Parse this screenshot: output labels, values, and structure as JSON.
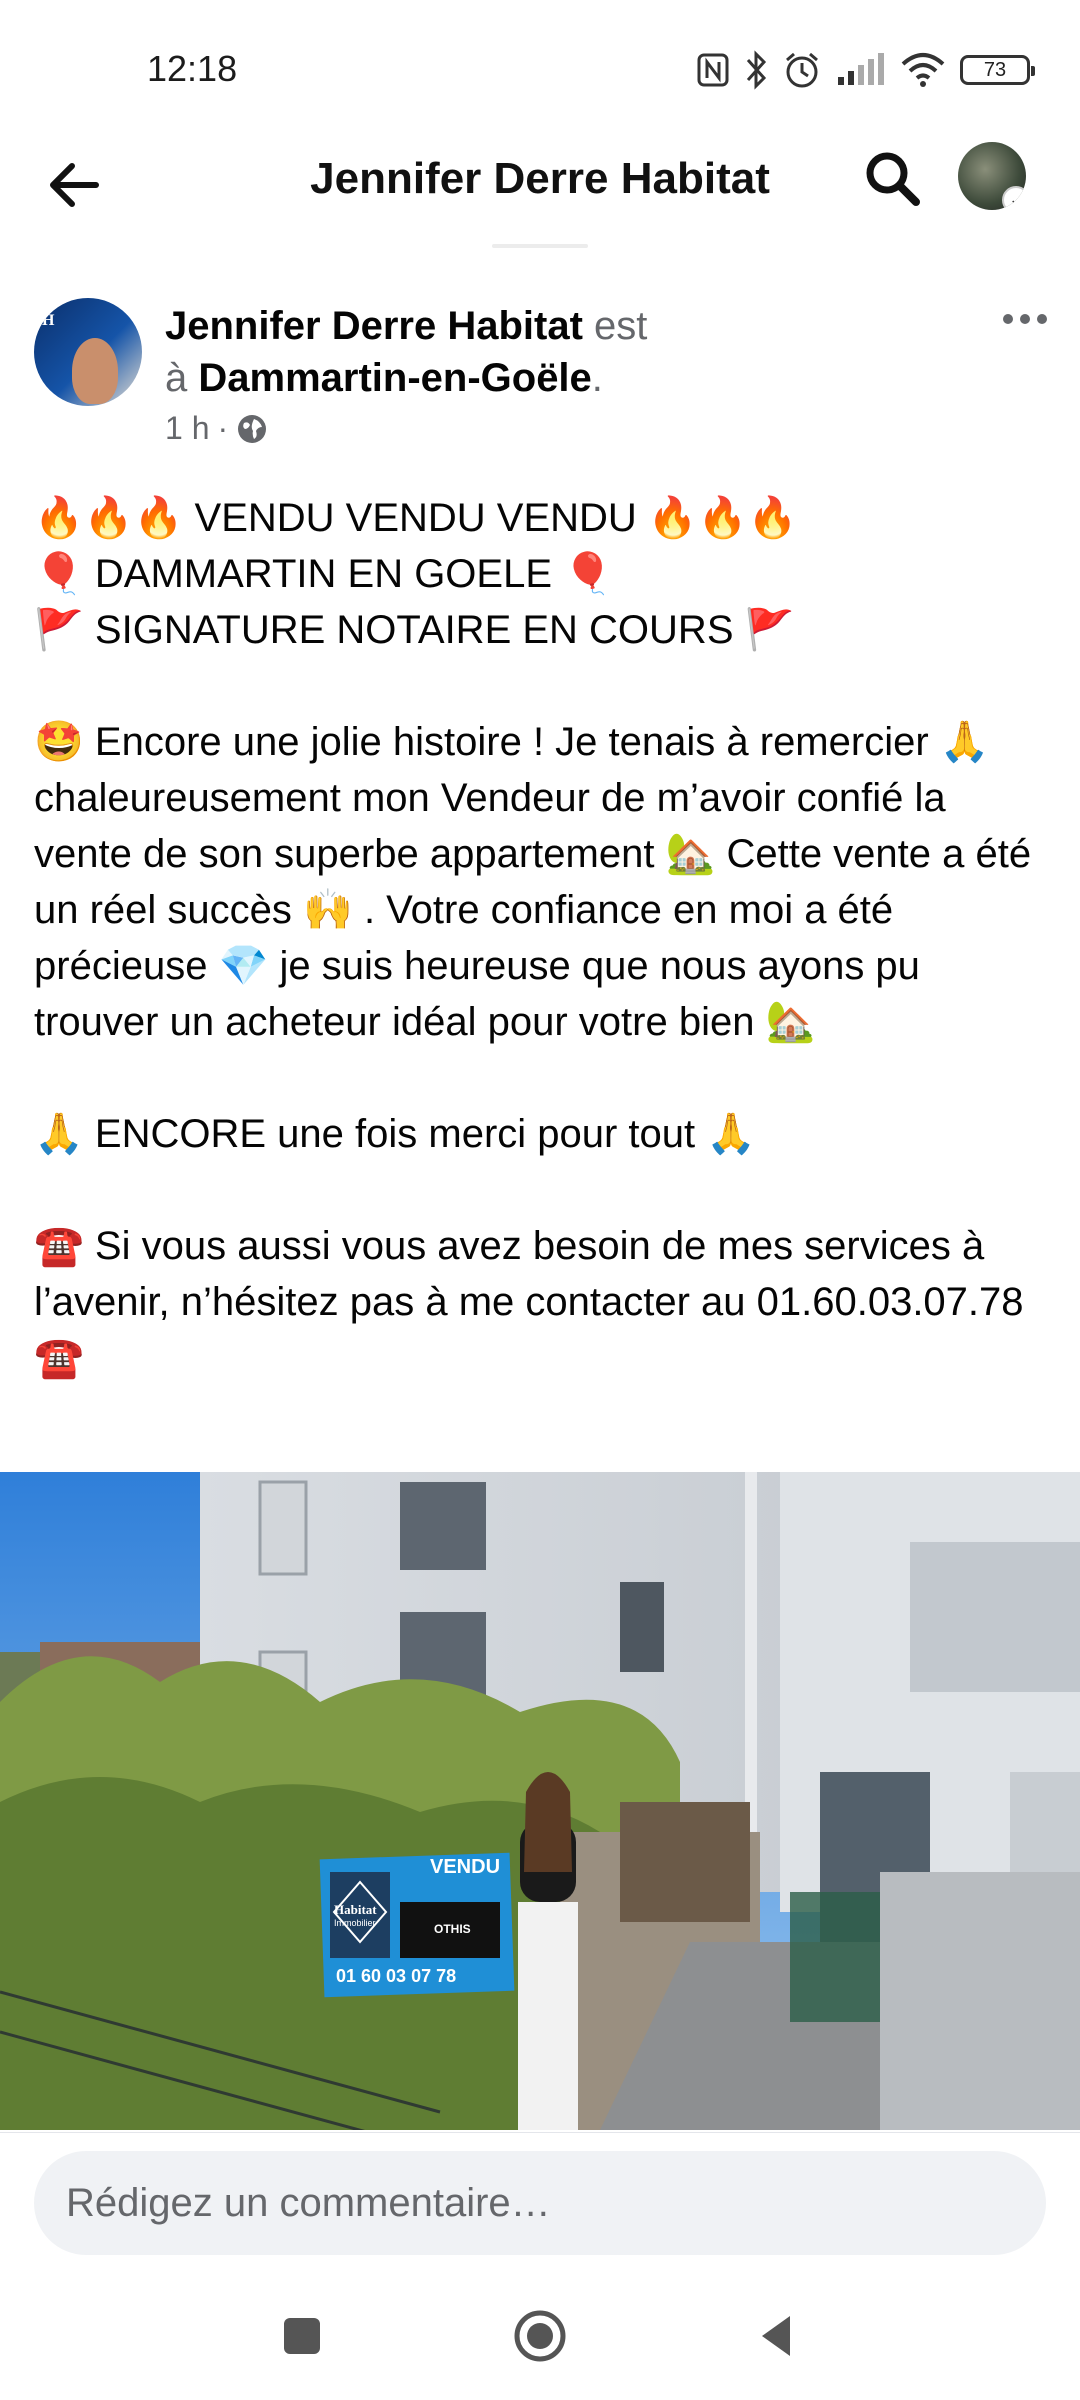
{
  "status_bar": {
    "time": "12:18",
    "battery": "73",
    "icons": [
      "nfc-icon",
      "bluetooth-icon",
      "alarm-icon",
      "signal-icon",
      "wifi-icon",
      "battery-icon"
    ]
  },
  "header": {
    "title": "Jennifer Derre Habitat",
    "icons": [
      "back-arrow-icon",
      "search-icon",
      "profile-avatar"
    ]
  },
  "post": {
    "author": "Jennifer Derre Habitat",
    "est": "est",
    "a": "à",
    "location": "Dammartin-en-Goële",
    "dot": ".",
    "time": "1 h",
    "sep": "·",
    "text": "🔥🔥🔥 VENDU VENDU VENDU 🔥🔥🔥\n🎈 DAMMARTIN EN GOELE 🎈\n🚩 SIGNATURE NOTAIRE EN COURS 🚩\n\n🤩 Encore une jolie histoire ! Je tenais à remercier 🙏 chaleureusement mon Vendeur de m’avoir confié la vente de son superbe appartement 🏡 Cette vente a été un réel succès 🙌 . Votre confiance en moi a été précieuse 💎 je suis heureuse que nous ayons pu trouver un acheteur idéal pour votre bien 🏡\n\n🙏 ENCORE une fois merci pour tout 🙏\n\n☎️ Si vous aussi vous avez besoin de mes services à l’avenir, n’hésitez pas à me contacter au 01.60.03.07.78 ☎️"
  },
  "photo": {
    "sign_top": "VENDU",
    "sign_brand": "Habitat",
    "sign_sub": "Immobilier",
    "sign_agent": "OTHIS",
    "sign_phone": "01 60 03 07 78"
  },
  "comment": {
    "placeholder": "Rédigez un commentaire…"
  },
  "colors": {
    "text": "#050505",
    "secondary": "#65676b",
    "input_bg": "#f0f2f5",
    "sign_blue": "#1f8fd6"
  }
}
